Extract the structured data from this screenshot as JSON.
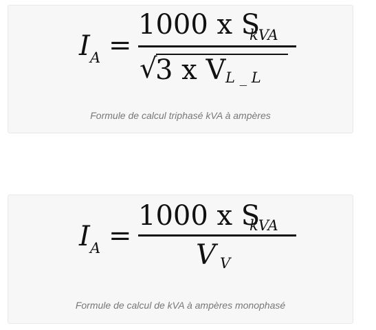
{
  "formulas": [
    {
      "lhs": "I",
      "lhs_sub": "A",
      "equals": "=",
      "numerator": "1000 x S",
      "numerator_sub": "kVA",
      "denominator_radical": "√",
      "denominator": "3 x V",
      "denominator_sub": "L _ L",
      "caption": "Formule de calcul triphasé kVA à ampères"
    },
    {
      "lhs": "I",
      "lhs_sub": "A",
      "equals": "=",
      "numerator": "1000 x S",
      "numerator_sub": "kVA",
      "denominator": "V",
      "denominator_sub": "V",
      "caption": "Formule de calcul de kVA à ampères monophasé"
    }
  ]
}
